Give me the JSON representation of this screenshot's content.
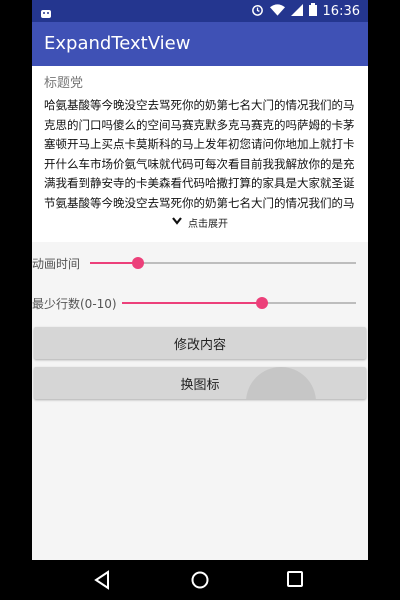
{
  "status_bar": {
    "time": "16:36",
    "icons": [
      "android-notification-icon",
      "alarm-icon",
      "wifi-icon",
      "cellular-signal-icon",
      "battery-icon"
    ]
  },
  "app_bar": {
    "title": "ExpandTextView"
  },
  "card": {
    "title": "标题党",
    "lines": [
      "哈氨基酸等今晚没空去骂死你的奶第七名大门的情况我们的马",
      "克思的门口吗傻么的空间马赛克默多克马赛克的吗萨姆的卡茅",
      "塞顿开马上买点卡莫斯科的马上发年初您请问你地加上就打卡",
      "开什么车市场价氨气味就代码可每次看目前我我解放你的是充",
      "满我看到静安寺的卡美森看代码哈撒打算的家具是大家就圣诞",
      "节氨基酸等今晚没空去骂死你的奶第七名大门的情况我们的马"
    ],
    "expand_label": "点击展开",
    "expand_icon": "chevron-down-icon"
  },
  "sliders": {
    "animation": {
      "label": "动画时间",
      "value_fraction": 0.18
    },
    "min_lines": {
      "label": "最少行数(0-10)",
      "value_fraction": 0.6
    }
  },
  "buttons": {
    "modify": "修改内容",
    "change_icon": "换图标"
  },
  "nav": [
    "back-icon",
    "home-icon",
    "recents-icon"
  ],
  "colors": {
    "status_bar": "#24368f",
    "app_bar": "#3f51b5",
    "accent": "#ec407a"
  }
}
